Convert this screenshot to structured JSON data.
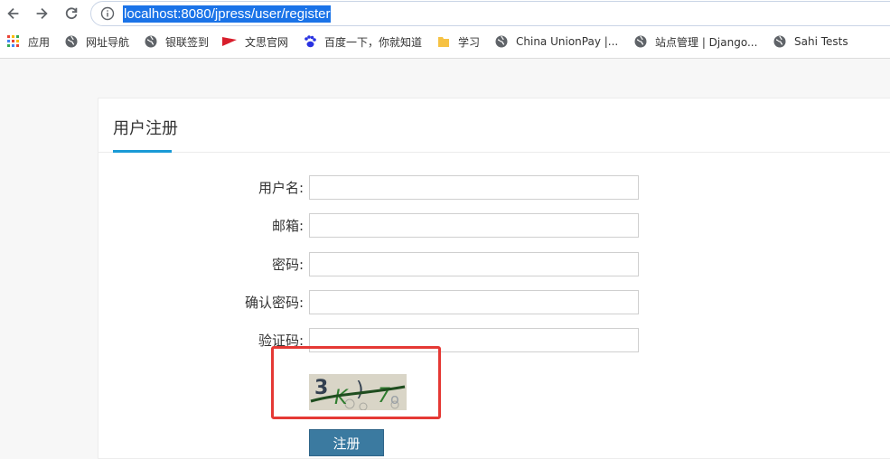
{
  "browser": {
    "url": "localhost:8080/jpress/user/register",
    "bookmarks": [
      {
        "label": "应用",
        "icon": "apps-grid-icon"
      },
      {
        "label": "网址导航",
        "icon": "globe-icon"
      },
      {
        "label": "银联签到",
        "icon": "globe-icon"
      },
      {
        "label": "文思官网",
        "icon": "red-flag-icon"
      },
      {
        "label": "百度一下，你就知道",
        "icon": "baidu-paw-icon"
      },
      {
        "label": "学习",
        "icon": "folder-icon"
      },
      {
        "label": "China UnionPay |...",
        "icon": "globe-icon"
      },
      {
        "label": "站点管理 | Django...",
        "icon": "globe-icon"
      },
      {
        "label": "Sahi Tests",
        "icon": "globe-icon"
      }
    ]
  },
  "register": {
    "title": "用户注册",
    "fields": [
      {
        "label": "用户名:",
        "value": ""
      },
      {
        "label": "邮箱:",
        "value": ""
      },
      {
        "label": "密码:",
        "value": ""
      },
      {
        "label": "确认密码:",
        "value": ""
      },
      {
        "label": "验证码:",
        "value": ""
      }
    ],
    "captcha_text": "3K)7o",
    "submit_label": "注册"
  },
  "colors": {
    "accent": "#1a9ad6",
    "button": "#3b7aa0",
    "highlight": "#e53935",
    "url_selection": "#1a73e8"
  }
}
